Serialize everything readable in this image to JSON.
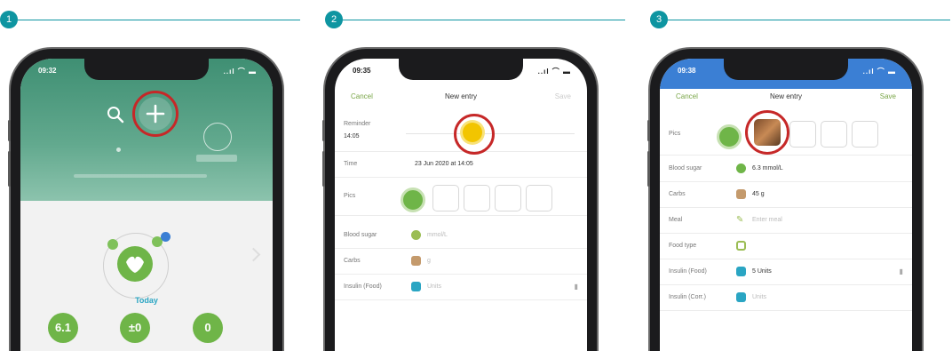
{
  "steps": [
    {
      "number": "1",
      "status_time": "09:32",
      "status_icons": "..ıl ⌒ ▬",
      "header_icons": [
        "search-icon",
        "plus-icon",
        "timer-icon"
      ],
      "day_label": "Today",
      "stat_values": [
        "6.1",
        "±0",
        "0"
      ]
    },
    {
      "number": "2",
      "status_time": "09:35",
      "status_icons": "..ıl ⌒ ▬",
      "nav": {
        "cancel": "Cancel",
        "title": "New entry",
        "save": "Save"
      },
      "reminder_label": "Reminder",
      "reminder_value": "14:05",
      "time_label": "Time",
      "time_value": "23 Jun 2020 at 14:05",
      "pics_label": "Pics",
      "rows": [
        {
          "label": "Blood sugar",
          "value": "mmol/L",
          "color": "#9bbd54"
        },
        {
          "label": "Carbs",
          "value": "g",
          "color": "#c49a6c"
        },
        {
          "label": "Insulin (Food)",
          "value": "Units",
          "color": "#2aa5c3"
        }
      ]
    },
    {
      "number": "3",
      "status_time": "09:38",
      "status_icons": "..ıl ⌒ ▬",
      "nav": {
        "cancel": "Cancel",
        "title": "New entry",
        "save": "Save"
      },
      "pics_label": "Pics",
      "rows": [
        {
          "label": "Blood sugar",
          "value": "6.3 mmol/L",
          "color": "#6fb548"
        },
        {
          "label": "Carbs",
          "value": "45 g",
          "color": "#c49a6c"
        },
        {
          "label": "Meal",
          "value": "Enter meal",
          "color": "#9bbd54"
        },
        {
          "label": "Food type",
          "value": "",
          "color": "#9bbd54"
        },
        {
          "label": "Insulin (Food)",
          "value": "5 Units",
          "color": "#2aa5c3"
        },
        {
          "label": "Insulin (Corr.)",
          "value": "Units",
          "color": "#2aa5c3"
        }
      ]
    }
  ],
  "colors": {
    "accent": "#0e95a1",
    "highlight": "#c62828",
    "app_green": "#6fb548"
  }
}
